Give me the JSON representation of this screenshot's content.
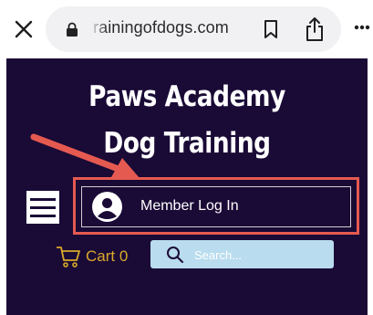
{
  "browser": {
    "url": "rainingofdogs.com",
    "icons": [
      "close-icon",
      "lock-icon",
      "bookmark-icon",
      "share-icon",
      "more-icon"
    ]
  },
  "site": {
    "title_line1": "Paws Academy",
    "title_line2": "Dog Training",
    "member_login_label": "Member Log In",
    "cart_label": "Cart 0",
    "search_placeholder": "Search...",
    "colors": {
      "background": "#1a0a36",
      "highlight": "#e55a50",
      "cart": "#d9a92a",
      "search_bg": "#b9dcee"
    }
  }
}
